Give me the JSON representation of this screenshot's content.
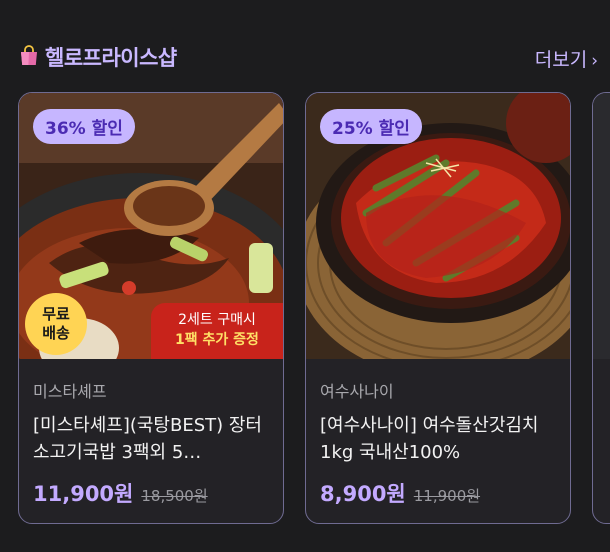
{
  "header": {
    "title": "헬로프라이스샵",
    "more_label": "더보기",
    "more_chevron": "›",
    "icon": "shopping-bag-icon"
  },
  "products": [
    {
      "discount": "36% 할인",
      "badge_free_ship": [
        "무료",
        "배송"
      ],
      "promo_line1": "2세트 구매시",
      "promo_line2": "1팩 추가 증정",
      "seller": "미스타셰프",
      "name": "[미스타셰프](국탕BEST) 장터소고기국밥 3팩외 5…",
      "price": "11,900원",
      "original_price": "18,500원"
    },
    {
      "discount": "25% 할인",
      "seller": "여수사나이",
      "name": "[여수사나이] 여수돌산갓김치 1kg 국내산100%",
      "price": "8,900원",
      "original_price": "11,900원"
    }
  ],
  "colors": {
    "background": "#1c1c1e",
    "accent": "#c3aaff",
    "card_border": "#6f6b92",
    "badge_bg": "#c6b6ff"
  }
}
